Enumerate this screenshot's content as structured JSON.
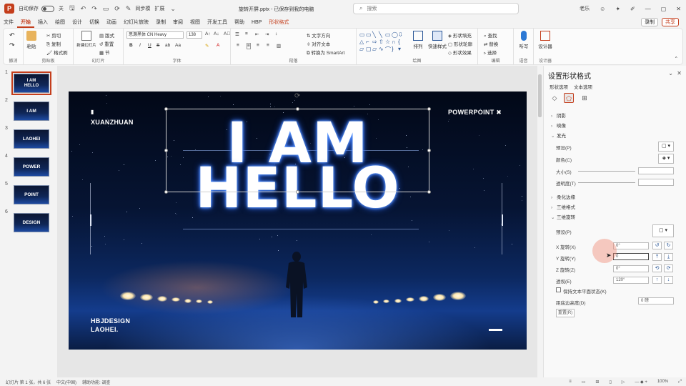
{
  "titlebar": {
    "autosave": "自动保存",
    "toggle_state": "关",
    "quick_text": "同步模",
    "tool_text": "扩展",
    "doc_title": "旋转开屏.pptx - 已保存到我的电脑",
    "search_placeholder": "搜索",
    "user": "老乐"
  },
  "tabs": [
    "文件",
    "开始",
    "插入",
    "绘图",
    "设计",
    "切换",
    "动画",
    "幻灯片放映",
    "录制",
    "审阅",
    "视图",
    "开发工具",
    "帮助",
    "HBP",
    "形状格式"
  ],
  "tabs_active": "开始",
  "tabs_right": {
    "record": "录制",
    "share": "共享"
  },
  "ribbon": {
    "undo_label": "撤消",
    "paste": "粘贴",
    "clipboard": "剪贴板",
    "cut": "剪切",
    "copy": "复制",
    "format_painter": "格式刷",
    "new_slide": "新建幻灯片",
    "layout": "版式",
    "reset": "重置",
    "section": "节",
    "slides": "幻灯片",
    "font_name": "思源黑体 CN Heavy",
    "font_size": "138",
    "font": "字体",
    "text_direction": "文字方向",
    "align_text": "对齐文本",
    "convert_smartart": "转换为 SmartArt",
    "paragraph": "段落",
    "arrange": "排列",
    "quick_styles": "快速样式",
    "shape_fill": "形状填充",
    "shape_outline": "形状轮廓",
    "shape_effects": "形状效果",
    "drawing": "绘图",
    "find": "查找",
    "replace": "替换",
    "select": "选择",
    "editing": "编辑",
    "dictate": "听写",
    "voice": "语音",
    "designer": "设计器",
    "designer_sub": "设计器"
  },
  "slides": [
    {
      "num": "1",
      "text": "I AM HELLO"
    },
    {
      "num": "2",
      "text": "I AM"
    },
    {
      "num": "3",
      "text": "LAOHEI"
    },
    {
      "num": "4",
      "text": "POWER"
    },
    {
      "num": "5",
      "text": "POINT"
    },
    {
      "num": "6",
      "text": "DESIGN"
    }
  ],
  "slide": {
    "top_left_mark": "▮",
    "top_left": "XUANZHUAN",
    "top_right": "POWERPOINT ✖",
    "title_line1": "I AM",
    "title_line2": "HELLO",
    "bottom_left_1": "HBJDESIGN",
    "bottom_left_2": "LAOHEI."
  },
  "pane": {
    "title": "设置形状格式",
    "sub_tabs": [
      "形状选项",
      "文本选项"
    ],
    "sections": {
      "shadow": "阴影",
      "reflection": "映像",
      "glow": "发光",
      "soft_edges": "柔化边缘",
      "format_3d": "三维格式",
      "rotation_3d": "三维旋转"
    },
    "glow_preset": "预设(P)",
    "glow_color": "颜色(C)",
    "glow_size": "大小(S)",
    "glow_transparency": "透明度(T)",
    "rot_preset": "预设(P)",
    "x_rotation": "X 旋转(X)",
    "x_value": "0°",
    "y_rotation": "Y 旋转(Y)",
    "y_value": "0",
    "z_rotation": "Z 旋转(Z)",
    "z_value": "0°",
    "perspective": "透视(E)",
    "perspective_value": "120°",
    "keep_flat": "保持文本平面状态(K)",
    "distance": "距底边高度(D)",
    "distance_value": "0 磅",
    "reset": "重置(R)"
  },
  "status": {
    "slide_count": "幻灯片 第 1 张，共 6 张",
    "language": "中文(中国)",
    "accessibility": "辅助功能: 调查",
    "zoom": "100%"
  },
  "colors": {
    "accent": "#c43e1c",
    "slide_bg_top": "#020817",
    "slide_bg_bottom": "#143c8c",
    "glow": "#3d7bff"
  }
}
